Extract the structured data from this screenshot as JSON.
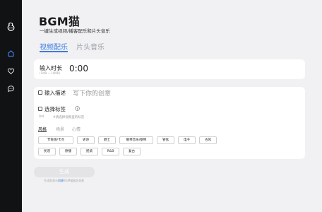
{
  "app": {
    "title": "BGM猫",
    "subtitle": "一键生成视频/播客配乐和片头音乐"
  },
  "sidebar": {
    "icons": [
      "logo-icon",
      "home-icon",
      "heart-icon",
      "chat-icon"
    ],
    "active_color": "#3d7be0"
  },
  "tabs": [
    {
      "label": "视频配乐",
      "active": true
    },
    {
      "label": "片头音乐",
      "active": false
    }
  ],
  "duration": {
    "label": "输入时长",
    "hint": "(1MB ~ 10MB)",
    "value": "0:00"
  },
  "description": {
    "label": "输入描述",
    "placeholder": "写下你的创意"
  },
  "tags": {
    "label": "选择标签",
    "count": "0/4",
    "hint": "#请选择视频里的标签",
    "sub_tabs": [
      {
        "label": "风格",
        "active": true
      },
      {
        "label": "场景",
        "active": false
      },
      {
        "label": "心情",
        "active": false
      }
    ],
    "row1": [
      "节奏感/卡点",
      "史诗",
      "爵士",
      "钢琴音乐/钢琴",
      "管弦",
      "电子",
      "古风"
    ],
    "row2": [
      "民谣",
      "原播",
      "摇滚",
      "R&B",
      "复古"
    ]
  },
  "generate_button": "生成",
  "footer": {
    "prefix": "生成即表示",
    "link": "同意",
    "suffix": "BGM猫服务条款"
  },
  "colors": {
    "accent": "#3d7be0",
    "sidebar_bg": "#111214",
    "page_bg": "#f1f1f3"
  }
}
